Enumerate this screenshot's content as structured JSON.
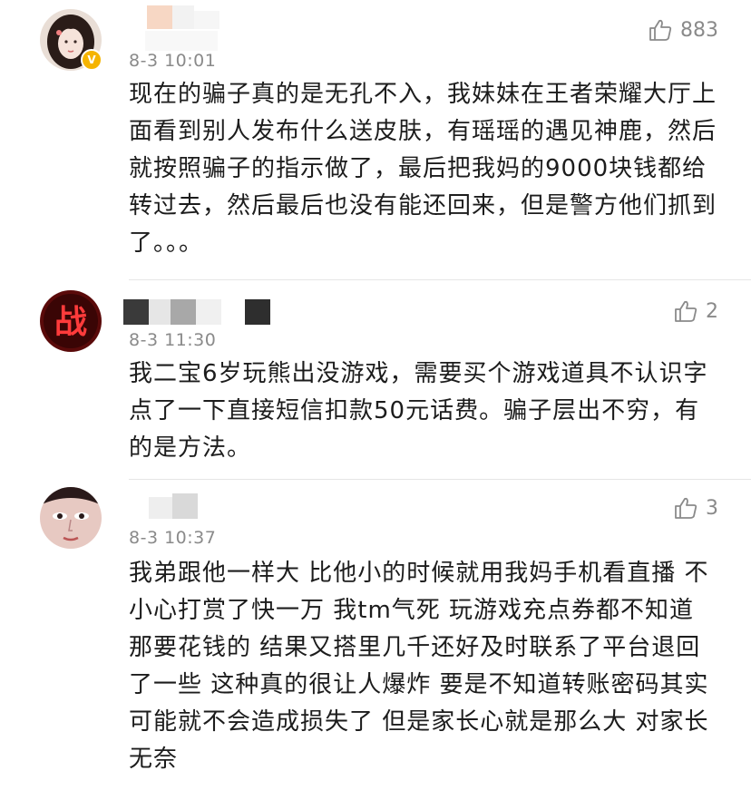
{
  "comments": [
    {
      "time": "8-3 10:01",
      "likes": "883",
      "verified": true,
      "text": "现在的骗子真的是无孔不入，我妹妹在王者荣耀大厅上面看到别人发布什么送皮肤，有瑶瑶的遇见神鹿，然后就按照骗子的指示做了，最后把我妈的9000块钱都给转过去，然后最后也没有能还回来，但是警方他们抓到了。。。"
    },
    {
      "time": "8-3 11:30",
      "likes": "2",
      "avatar_text": "战",
      "text": "我二宝6岁玩熊出没游戏，需要买个游戏道具不认识字点了一下直接短信扣款50元话费。骗子层出不穷，有的是方法。"
    },
    {
      "time": "8-3 10:37",
      "likes": "3",
      "text": "我弟跟他一样大 比他小的时候就用我妈手机看直播 不小心打赏了快一万 我tm气死 玩游戏充点券都不知道那要花钱的 结果又搭里几千还好及时联系了平台退回了一些 这种真的很让人爆炸 要是不知道转账密码其实可能就不会造成损失了 但是家长心就是那么大 对家长无奈"
    }
  ],
  "icons": {
    "like": "thumbs-up-icon",
    "verified": "verified-badge-icon"
  },
  "colors": {
    "time": "#8a8a8a",
    "text": "#1c1c1c",
    "verified": "#f5b400"
  }
}
